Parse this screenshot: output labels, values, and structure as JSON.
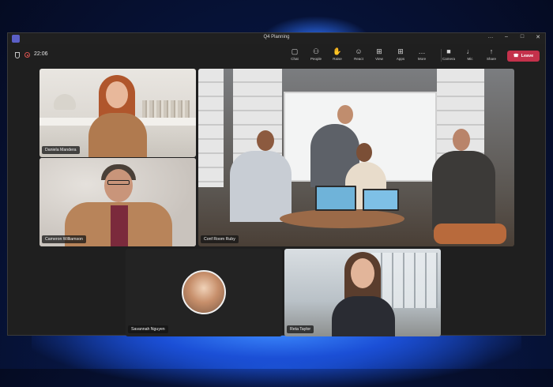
{
  "window": {
    "title": "Q4 Planning",
    "controls": [
      "…",
      "–",
      "□",
      "✕"
    ]
  },
  "call": {
    "timer": "22:06",
    "recording_color": "#d9534f"
  },
  "toolbar": {
    "items": [
      {
        "id": "chat",
        "label": "Chat",
        "icon": "chat-icon",
        "glyph": "▢"
      },
      {
        "id": "people",
        "label": "People",
        "icon": "people-icon",
        "glyph": "⚇"
      },
      {
        "id": "raise",
        "label": "Raise",
        "icon": "hand-icon",
        "glyph": "✋"
      },
      {
        "id": "react",
        "label": "React",
        "icon": "smile-icon",
        "glyph": "☺"
      },
      {
        "id": "view",
        "label": "View",
        "icon": "grid-icon",
        "glyph": "⊞"
      },
      {
        "id": "apps",
        "label": "Apps",
        "icon": "apps-icon",
        "glyph": "⊞"
      },
      {
        "id": "more",
        "label": "More",
        "icon": "more-icon",
        "glyph": "…"
      },
      {
        "id": "camera",
        "label": "Camera",
        "icon": "camera-icon",
        "glyph": "■"
      },
      {
        "id": "mic",
        "label": "Mic",
        "icon": "mic-icon",
        "glyph": "♩"
      },
      {
        "id": "share",
        "label": "Share",
        "icon": "share-icon",
        "glyph": "↑"
      }
    ],
    "leave_label": "Leave",
    "leave_icon": "phone-hangup-icon",
    "leave_color": "#c4314b"
  },
  "participants": [
    {
      "id": "daniela",
      "name": "Daniela Mandera"
    },
    {
      "id": "cameron",
      "name": "Cameron Williamson"
    },
    {
      "id": "conf",
      "name": "Conf Room Ruby"
    },
    {
      "id": "savannah",
      "name": "Savannah Nguyen"
    },
    {
      "id": "reta",
      "name": "Reta Taylor"
    }
  ],
  "colors": {
    "window_bg": "#1f1f1f",
    "accent": "#5b5fc7"
  }
}
